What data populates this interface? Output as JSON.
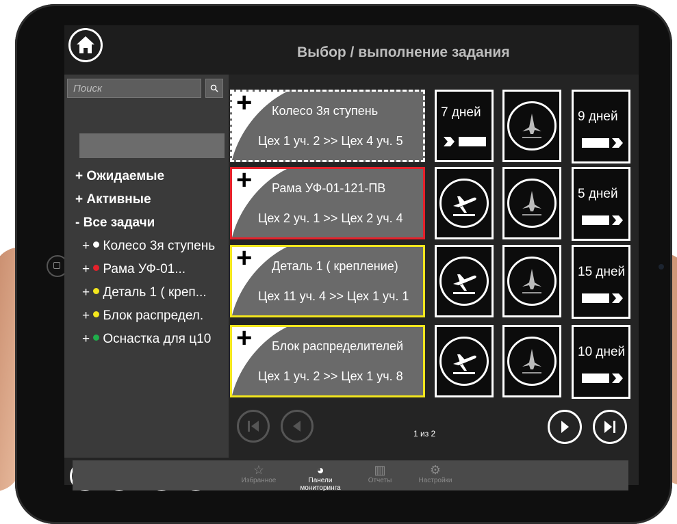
{
  "header": {
    "title": "Выбор / выполнение задания"
  },
  "search": {
    "placeholder": "Поиск"
  },
  "sidebar": {
    "groups": [
      {
        "label": "+ Ожидаемые"
      },
      {
        "label": "+ Активные"
      },
      {
        "label": "- Все задачи"
      }
    ],
    "items": [
      {
        "prefix": "+",
        "label": "Колесо 3я ступень",
        "dot_color": "#ffffff"
      },
      {
        "prefix": "+",
        "label": "Рама УФ-01...",
        "dot_color": "#e5212b"
      },
      {
        "prefix": "+",
        "label": "Деталь 1 ( креп...",
        "dot_color": "#f3e61d"
      },
      {
        "prefix": "+",
        "label": "Блок распредел.",
        "dot_color": "#f3e61d"
      },
      {
        "prefix": "+",
        "label": "Оснастка для ц10",
        "dot_color": "#1fae4b"
      }
    ]
  },
  "tasks": [
    {
      "plus": "+",
      "name": "Колесо 3я ступень",
      "route": "Цех 1 уч. 2 >> Цех 4 уч. 5",
      "status": "dashed-white",
      "start_tile": "7 дней",
      "end_days": "9 дней"
    },
    {
      "plus": "+",
      "name": "Рама УФ-01-121-ПВ",
      "route": "Цех 2 уч. 1 >> Цех 2 уч. 4",
      "status": "red",
      "start_tile": "departure-icon",
      "end_days": "5 дней"
    },
    {
      "plus": "+",
      "name": "Деталь 1 ( крепление)",
      "route": "Цех 11 уч. 4 >> Цех 1 уч. 1",
      "status": "yellow",
      "start_tile": "departure-icon",
      "end_days": "15 дней"
    },
    {
      "plus": "+",
      "name": "Блок распределителей",
      "route": "Цех 1 уч. 2 >> Цех 1 уч. 8",
      "status": "yellow",
      "start_tile": "departure-icon",
      "end_days": "10 дней"
    }
  ],
  "pager": {
    "text": "1 из 2"
  },
  "tabs": [
    {
      "label": "Избранное",
      "icon": "star-icon",
      "active": false
    },
    {
      "label": "Панели мониторинга",
      "icon": "gauge-icon",
      "active": true
    },
    {
      "label": "Отчеты",
      "icon": "bar-chart-icon",
      "active": false
    },
    {
      "label": "Настройки",
      "icon": "gear-icon",
      "active": false
    }
  ],
  "colors": {
    "red": "#e5212b",
    "yellow": "#f3e61d",
    "green": "#1fae4b"
  }
}
